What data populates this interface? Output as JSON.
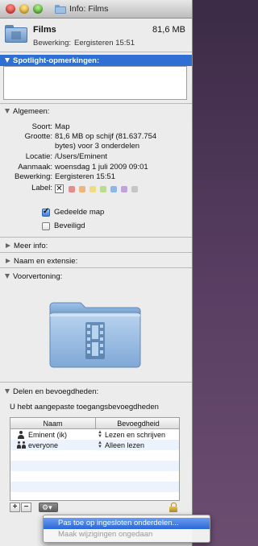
{
  "window": {
    "title": "Info: Films"
  },
  "header": {
    "file_name": "Films",
    "size": "81,6 MB",
    "modified_label": "Bewerking:",
    "modified_value": "Eergisteren 15:51"
  },
  "sections": {
    "spotlight": "Spotlight-opmerkingen:",
    "general": "Algemeen:",
    "more_info": "Meer info:",
    "name_ext": "Naam en extensie:",
    "preview": "Voorvertoning:",
    "sharing": "Delen en bevoegdheden:"
  },
  "general": {
    "kind_label": "Soort:",
    "kind_value": "Map",
    "size_label": "Grootte:",
    "size_line1": "81,6 MB op schijf (81.637.754",
    "size_line2": "bytes) voor 3 onderdelen",
    "location_label": "Locatie:",
    "location_value": "/Users/Eminent",
    "created_label": "Aanmaak:",
    "created_value": "woensdag 1 juli 2009 09:01",
    "modified_label": "Bewerking:",
    "modified_value": "Eergisteren 15:51",
    "label_label": "Label:",
    "label_none": "✕",
    "label_colors": [
      "#e56b6b",
      "#f2a15a",
      "#f2d65a",
      "#a9d86a",
      "#6aa7e8",
      "#b48ad8",
      "#b9b9b9"
    ],
    "shared_folder_label": "Gedeelde map",
    "shared_folder_checked": true,
    "locked_label": "Beveiligd",
    "locked_checked": false
  },
  "sharing": {
    "notice": "U hebt aangepaste toegangsbevoegdheden",
    "col_name": "Naam",
    "col_privilege": "Bevoegdheid",
    "rows": [
      {
        "name": "Eminent (ik)",
        "privilege": "Lezen en schrijven",
        "icon": "user-icon"
      },
      {
        "name": "everyone",
        "privilege": "Alleen lezen",
        "icon": "group-icon"
      }
    ],
    "add_label": "+",
    "remove_label": "−",
    "gear_label": "⚙▾"
  },
  "popup_menu": {
    "items": [
      {
        "label": "Pas toe op ingesloten onderdelen...",
        "selected": true,
        "enabled": true
      },
      {
        "label": "Maak wijzigingen ongedaan",
        "selected": false,
        "enabled": false
      }
    ]
  },
  "colors": {
    "selection_blue": "#2f6fd3",
    "folder_blue": "#8fb6e0"
  }
}
